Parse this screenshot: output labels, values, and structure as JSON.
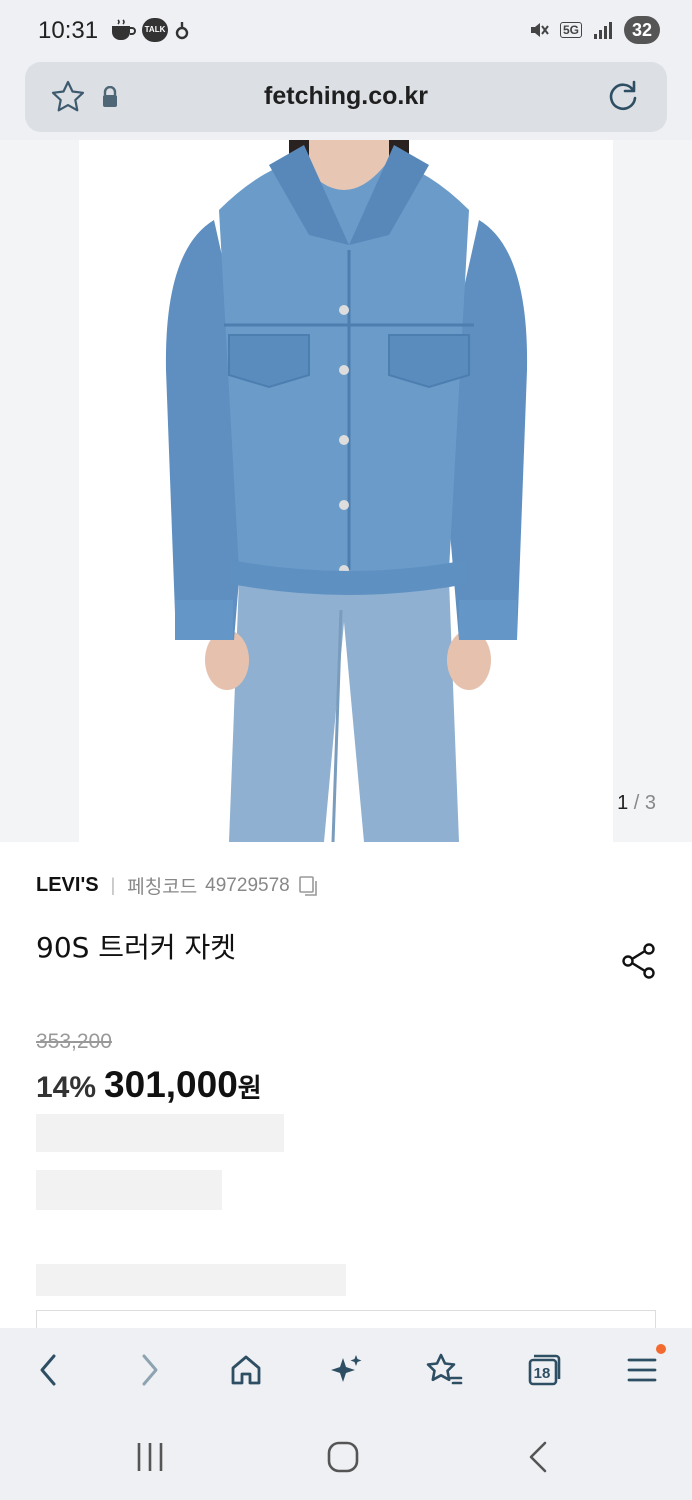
{
  "status_bar": {
    "time": "10:31",
    "left_icons": [
      "coffee-icon",
      "kakaotalk-icon",
      "notification-icon"
    ],
    "talk_badge": "TALK",
    "network": "5G",
    "battery": "32"
  },
  "address_bar": {
    "url": "fetching.co.kr"
  },
  "gallery": {
    "current": "1",
    "separator": " / ",
    "total": "3"
  },
  "product": {
    "brand": "LEVI'S",
    "code_label": "페칭코드",
    "code_value": "49729578",
    "name": "90S 트러커 자켓",
    "original_price": "353,200",
    "discount": "14%",
    "price": "301,000",
    "currency": "원"
  },
  "colors": {
    "accent_icon": "#2d4e63",
    "notification": "#f36a2f",
    "chrome_bg": "#eef0f3"
  }
}
